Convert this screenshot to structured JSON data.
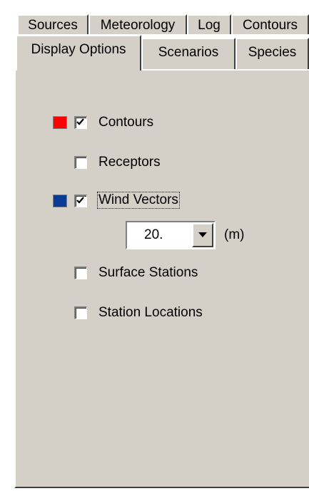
{
  "tabs": {
    "row1": [
      "Sources",
      "Meteorology",
      "Log",
      "Contours"
    ],
    "row2": [
      "Display Options",
      "Scenarios",
      "Species"
    ],
    "active": "Display Options"
  },
  "options": {
    "contours": {
      "label": "Contours",
      "checked": true,
      "color": "#ff0000"
    },
    "receptors": {
      "label": "Receptors",
      "checked": false
    },
    "wind_vectors": {
      "label": "Wind Vectors",
      "checked": true,
      "color": "#0a3c96"
    },
    "surface_stations": {
      "label": "Surface Stations",
      "checked": false
    },
    "station_locations": {
      "label": "Station Locations",
      "checked": false
    }
  },
  "vector_scale": {
    "value": "20.",
    "unit": "(m)"
  },
  "icons": {
    "dropdown": "chevron-down-icon",
    "check": "check-icon"
  }
}
